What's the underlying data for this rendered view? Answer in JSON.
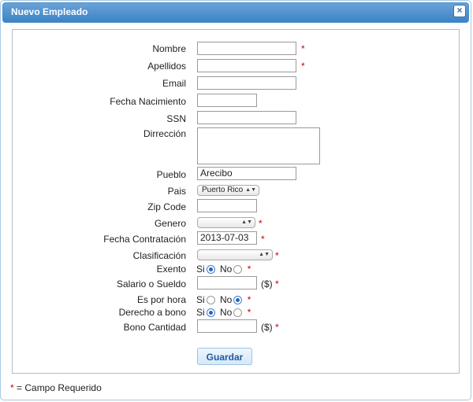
{
  "dialog": {
    "title": "Nuevo Empleado",
    "close_glyph": "×"
  },
  "form": {
    "nombre": {
      "label": "Nombre",
      "value": ""
    },
    "apellidos": {
      "label": "Apellidos",
      "value": ""
    },
    "email": {
      "label": "Email",
      "value": ""
    },
    "fecha_nacimiento": {
      "label": "Fecha Nacimiento",
      "value": ""
    },
    "ssn": {
      "label": "SSN",
      "value": ""
    },
    "direccion": {
      "label": "Dirrección",
      "value": ""
    },
    "pueblo": {
      "label": "Pueblo",
      "value": "Arecibo"
    },
    "pais": {
      "label": "Pais",
      "value": "Puerto Rico"
    },
    "zip": {
      "label": "Zip Code",
      "value": ""
    },
    "genero": {
      "label": "Genero",
      "value": ""
    },
    "fecha_contratacion": {
      "label": "Fecha Contratación",
      "value": "2013-07-03"
    },
    "clasificacion": {
      "label": "Clasificación",
      "value": ""
    },
    "exento": {
      "label": "Exento",
      "si": "Si",
      "no": "No",
      "selected": "Si"
    },
    "salario": {
      "label": "Salario o Sueldo",
      "value": "",
      "unit": "($)"
    },
    "por_hora": {
      "label": "Es por hora",
      "si": "Si",
      "no": "No",
      "selected": "No"
    },
    "derecho_bono": {
      "label": "Derecho a bono",
      "si": "Si",
      "no": "No",
      "selected": "Si"
    },
    "bono_cantidad": {
      "label": "Bono Cantidad",
      "value": "",
      "unit": "($)"
    },
    "required_mark": "*",
    "submit_label": "Guardar"
  },
  "footer": {
    "star": "*",
    "text": " = Campo Requerido"
  },
  "colors": {
    "title_bar": "#3b83c6",
    "required": "#cc0000",
    "button_text": "#1d5c9c"
  }
}
